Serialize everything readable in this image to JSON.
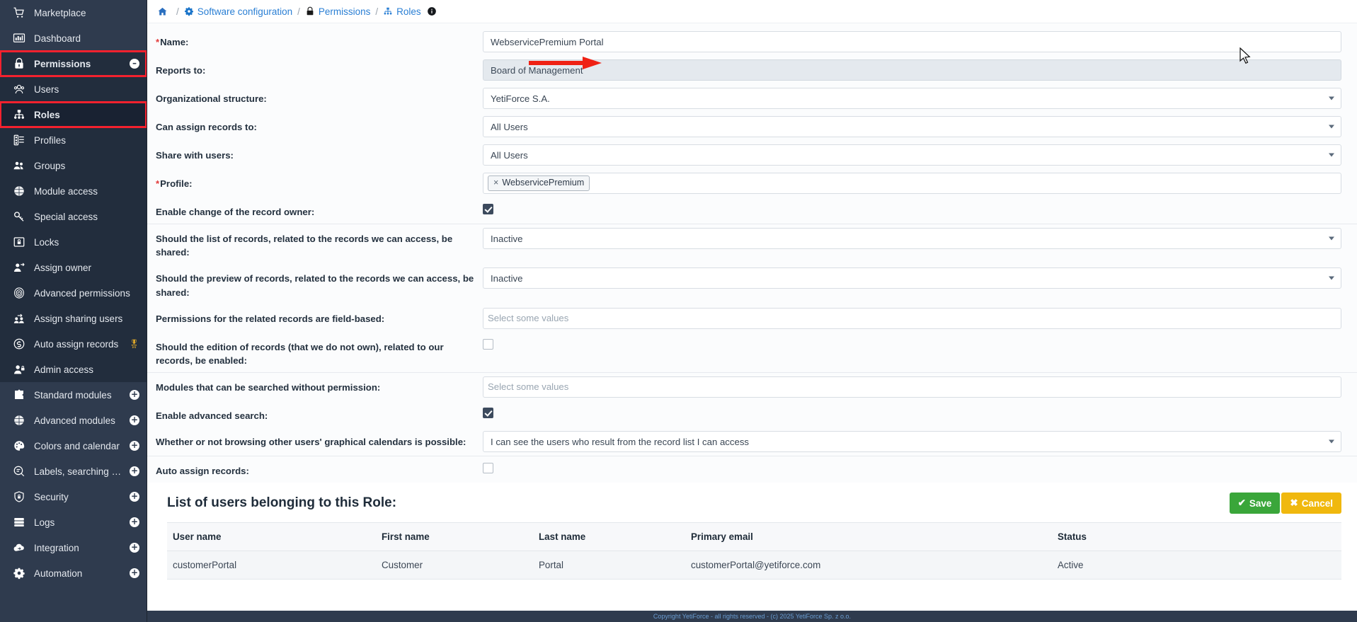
{
  "sidebar": {
    "items": [
      {
        "label": "Marketplace",
        "icon": "cart-icon",
        "expandable": false,
        "state": "normal"
      },
      {
        "label": "Dashboard",
        "icon": "dashboard-icon",
        "expandable": false,
        "state": "normal"
      },
      {
        "label": "Permissions",
        "icon": "lock-icon",
        "expandable": true,
        "toggle": "minus",
        "state": "highlighted"
      },
      {
        "label": "Users",
        "icon": "users-icon",
        "expandable": false,
        "state": "child"
      },
      {
        "label": "Roles",
        "icon": "sitemap-icon",
        "expandable": false,
        "state": "selected"
      },
      {
        "label": "Profiles",
        "icon": "list-icon",
        "expandable": false,
        "state": "child"
      },
      {
        "label": "Groups",
        "icon": "group-icon",
        "expandable": false,
        "state": "child"
      },
      {
        "label": "Module access",
        "icon": "cube-icon",
        "expandable": false,
        "state": "child"
      },
      {
        "label": "Special access",
        "icon": "key-icon",
        "expandable": false,
        "state": "child"
      },
      {
        "label": "Locks",
        "icon": "padlock-box-icon",
        "expandable": false,
        "state": "child"
      },
      {
        "label": "Assign owner",
        "icon": "assign-owner-icon",
        "expandable": false,
        "state": "child"
      },
      {
        "label": "Advanced permissions",
        "icon": "fingerprint-icon",
        "expandable": false,
        "state": "child"
      },
      {
        "label": "Assign sharing users",
        "icon": "share-users-icon",
        "expandable": false,
        "state": "child"
      },
      {
        "label": "Auto assign records",
        "icon": "auto-assign-icon",
        "expandable": false,
        "state": "child",
        "badge": "premium-badge"
      },
      {
        "label": "Admin access",
        "icon": "admin-user-icon",
        "expandable": false,
        "state": "child"
      },
      {
        "label": "Standard modules",
        "icon": "puzzle-icon",
        "expandable": true,
        "toggle": "plus",
        "state": "normal"
      },
      {
        "label": "Advanced modules",
        "icon": "cube-icon",
        "expandable": true,
        "toggle": "plus",
        "state": "normal"
      },
      {
        "label": "Colors and calendar",
        "icon": "palette-icon",
        "expandable": true,
        "toggle": "plus",
        "state": "normal"
      },
      {
        "label": "Labels, searching an...",
        "icon": "search-doc-icon",
        "expandable": true,
        "toggle": "plus",
        "state": "normal"
      },
      {
        "label": "Security",
        "icon": "shield-icon",
        "expandable": true,
        "toggle": "plus",
        "state": "normal"
      },
      {
        "label": "Logs",
        "icon": "server-icon",
        "expandable": true,
        "toggle": "plus",
        "state": "normal"
      },
      {
        "label": "Integration",
        "icon": "cloud-sync-icon",
        "expandable": true,
        "toggle": "plus",
        "state": "normal"
      },
      {
        "label": "Automation",
        "icon": "cogs-icon",
        "expandable": true,
        "toggle": "plus",
        "state": "normal"
      }
    ]
  },
  "breadcrumb": {
    "home_icon": "home-icon",
    "items": [
      {
        "label": "Software configuration",
        "icon": "gear-icon"
      },
      {
        "label": "Permissions",
        "icon": "lock-icon"
      },
      {
        "label": "Roles",
        "icon": "sitemap-icon"
      }
    ],
    "info_icon": "info-icon",
    "separator": "/"
  },
  "form": {
    "rows": [
      {
        "label": "Name:",
        "required": true,
        "type": "text",
        "value": "WebservicePremium Portal",
        "annotated": true
      },
      {
        "label": "Reports to:",
        "required": false,
        "type": "readonly",
        "value": "Board of Management"
      },
      {
        "label": "Organizational structure:",
        "required": false,
        "type": "select",
        "value": "YetiForce S.A."
      },
      {
        "label": "Can assign records to:",
        "required": false,
        "type": "select",
        "value": "All Users"
      },
      {
        "label": "Share with users:",
        "required": false,
        "type": "select",
        "value": "All Users"
      },
      {
        "label": "Profile:",
        "required": true,
        "type": "tags",
        "tags": [
          {
            "remove": "×",
            "label": "WebservicePremium"
          }
        ]
      },
      {
        "label": "Enable change of the record owner:",
        "required": false,
        "type": "checkbox",
        "checked": true
      },
      {
        "label": "Should the list of records, related to the records we can access, be shared:",
        "required": false,
        "type": "select",
        "value": "Inactive",
        "divider": true
      },
      {
        "label": "Should the preview of records, related to the records we can access, be shared:",
        "required": false,
        "type": "select",
        "value": "Inactive"
      },
      {
        "label": "Permissions for the related records are field-based:",
        "required": false,
        "type": "multiselect",
        "placeholder": "Select some values"
      },
      {
        "label": "Should the edition of records (that we do not own), related to our records, be enabled:",
        "required": false,
        "type": "checkbox",
        "checked": false
      },
      {
        "label": "Modules that can be searched without permission:",
        "required": false,
        "type": "multiselect",
        "placeholder": "Select some values",
        "divider": true
      },
      {
        "label": "Enable advanced search:",
        "required": false,
        "type": "checkbox",
        "checked": true
      },
      {
        "label": "Whether or not browsing other users' graphical calendars is possible:",
        "required": false,
        "type": "select",
        "value": "I can see the users who result from the record list I can access"
      },
      {
        "label": "Auto assign records:",
        "required": false,
        "type": "checkbox",
        "checked": false,
        "divider": true
      }
    ]
  },
  "list_section": {
    "title": "List of users belonging to this Role:",
    "save_label": "Save",
    "cancel_label": "Cancel",
    "save_icon": "check-icon",
    "cancel_icon": "close-icon",
    "columns": [
      "User name",
      "First name",
      "Last name",
      "Primary email",
      "Status"
    ],
    "rows": [
      [
        "customerPortal",
        "Customer",
        "Portal",
        "customerPortal@yetiforce.com",
        "Active"
      ]
    ]
  },
  "footer": {
    "text": "Copyright YetiForce - all rights reserved - (c) 2025 YetiForce Sp. z o.o."
  },
  "colors": {
    "sidebar_bg": "#2f3b4e",
    "sidebar_dark": "#222d3d",
    "highlight": "#f4212e",
    "link": "#2a7fd4",
    "save_green": "#3aa63a",
    "cancel_yellow": "#f0b80e",
    "required_red": "#e23b3b"
  }
}
